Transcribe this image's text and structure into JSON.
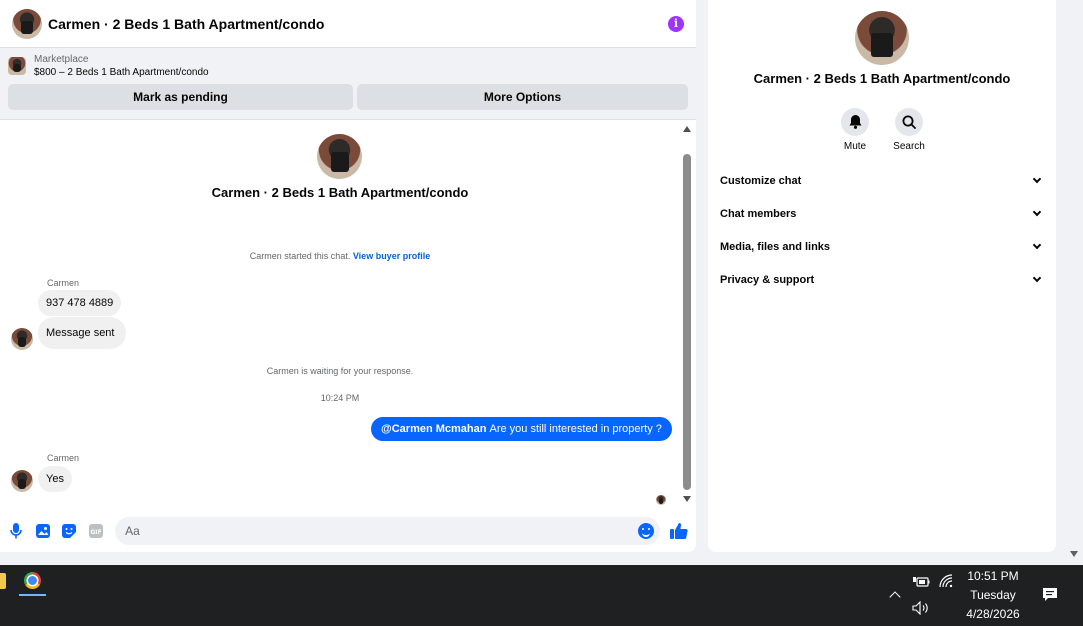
{
  "chat": {
    "title": "Carmen · 2 Beds 1 Bath Apartment/condo",
    "marketplace": {
      "label": "Marketplace",
      "listing": "$800 – 2 Beds 1 Bath Apartment/condo",
      "mark_pending": "Mark as pending",
      "more_options": "More Options"
    },
    "intro_name": "Carmen · 2 Beds 1 Bath Apartment/condo",
    "started_text": "Carmen started this chat.",
    "view_profile": "View buyer profile",
    "sender1": "Carmen",
    "msg1": "937 478 4889",
    "msg2": "Message sent",
    "waiting": "Carmen is waiting for your response.",
    "time": "10:24 PM",
    "out_mention": "@Carmen Mcmahan",
    "out_text": "Are you still interested in property ?",
    "sender2": "Carmen",
    "msg3": "Yes",
    "composer_placeholder": "Aa"
  },
  "info_panel": {
    "name": "Carmen · 2 Beds 1 Bath Apartment/condo",
    "mute": "Mute",
    "search": "Search",
    "rows": [
      "Customize chat",
      "Chat members",
      "Media, files and links",
      "Privacy & support"
    ]
  },
  "taskbar": {
    "time": "10:51 PM",
    "day": "Tuesday",
    "date": "4/28/2026"
  },
  "colors": {
    "accent": "#0866ff",
    "info": "#a033ff"
  }
}
